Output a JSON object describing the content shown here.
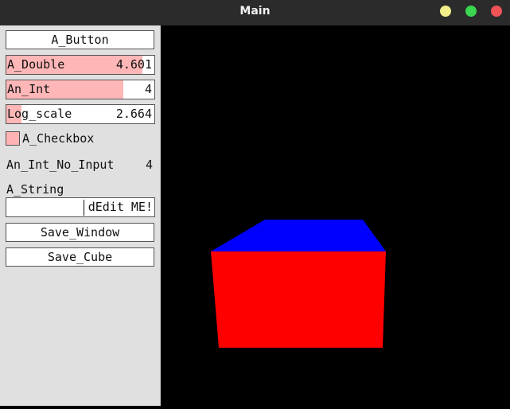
{
  "window": {
    "title": "Main"
  },
  "panel": {
    "button": "A_Button",
    "double": {
      "label": "A_Double",
      "value": "4.601",
      "fraction": 0.92
    },
    "int": {
      "label": "An_Int",
      "value": "4",
      "fraction": 0.79
    },
    "log": {
      "label": "Log_scale",
      "value": "2.664",
      "fraction": 0.1
    },
    "checkbox": {
      "label": "A_Checkbox",
      "checked": true
    },
    "int_no_input": {
      "label": "An_Int_No_Input",
      "value": "4"
    },
    "string": {
      "label": "A_String",
      "value": "dEdit ME!"
    },
    "save_window": "Save_Window",
    "save_cube": "Save_Cube"
  },
  "colors": {
    "slider_fill": "#ffb6b6",
    "cube_top": "#0000ff",
    "cube_front": "#ff0000",
    "background": "#000000"
  }
}
